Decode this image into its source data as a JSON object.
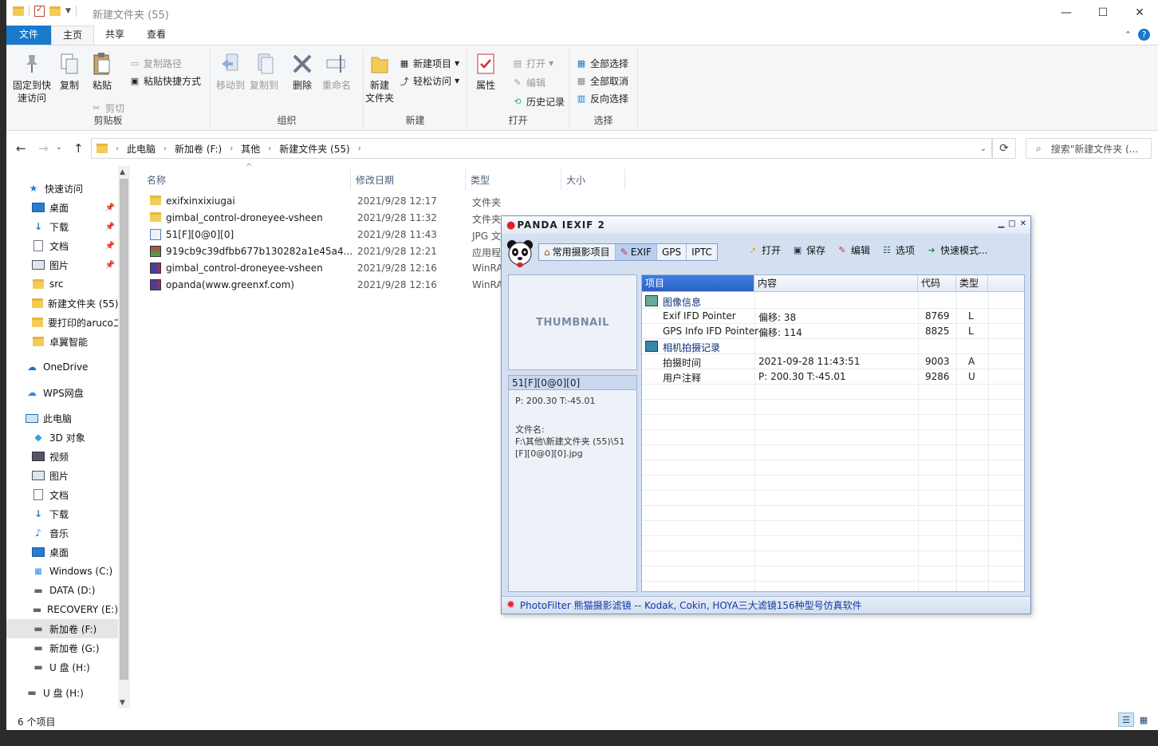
{
  "window": {
    "title": "新建文件夹 (55)"
  },
  "tabs": {
    "file": "文件",
    "home": "主页",
    "share": "共享",
    "view": "查看"
  },
  "ribbon": {
    "clipboard": {
      "label": "剪贴板",
      "pin": "固定到快速访问",
      "copy": "复制",
      "paste": "粘贴",
      "copy_path": "复制路径",
      "paste_shortcut": "粘贴快捷方式",
      "cut": "剪切"
    },
    "organize": {
      "label": "组织",
      "move_to": "移动到",
      "copy_to": "复制到",
      "delete": "删除",
      "rename": "重命名"
    },
    "new": {
      "label": "新建",
      "new_folder": "新建\n文件夹",
      "new_item": "新建项目",
      "easy_access": "轻松访问"
    },
    "open": {
      "label": "打开",
      "properties": "属性",
      "open": "打开",
      "edit": "编辑",
      "history": "历史记录"
    },
    "select": {
      "label": "选择",
      "select_all": "全部选择",
      "select_none": "全部取消",
      "invert": "反向选择"
    }
  },
  "address": {
    "crumbs": [
      "此电脑",
      "新加卷 (F:)",
      "其他",
      "新建文件夹 (55)"
    ],
    "search_placeholder": "搜索\"新建文件夹 (..."
  },
  "nav": {
    "quick_access": "快速访问",
    "items": [
      "桌面",
      "下载",
      "文档",
      "图片",
      "src",
      "新建文件夹 (55)",
      "要打印的aruco二",
      "卓翼智能"
    ],
    "onedrive": "OneDrive",
    "wps": "WPS网盘",
    "this_pc": "此电脑",
    "pc_items": [
      "3D 对象",
      "视频",
      "图片",
      "文档",
      "下载",
      "音乐",
      "桌面",
      "Windows (C:)",
      "DATA (D:)",
      "RECOVERY (E:)",
      "新加卷 (F:)",
      "新加卷 (G:)",
      "U 盘 (H:)"
    ],
    "usb": "U 盘 (H:)"
  },
  "columns": {
    "name": "名称",
    "date": "修改日期",
    "type": "类型",
    "size": "大小"
  },
  "files": [
    {
      "name": "exifxinxixiugai",
      "date": "2021/9/28 12:17",
      "type": "文件夹",
      "icon": "folder"
    },
    {
      "name": "gimbal_control-droneyee-vsheen",
      "date": "2021/9/28 11:32",
      "type": "文件夹",
      "icon": "folder"
    },
    {
      "name": "51[F][0@0][0]",
      "date": "2021/9/28 11:43",
      "type": "JPG 文",
      "icon": "jpg"
    },
    {
      "name": "919cb9c39dfbb677b130282a1e45a4...",
      "date": "2021/9/28 12:21",
      "type": "应用程",
      "icon": "exe"
    },
    {
      "name": "gimbal_control-droneyee-vsheen",
      "date": "2021/9/28 12:16",
      "type": "WinRA",
      "icon": "rar"
    },
    {
      "name": "opanda(www.greenxf.com)",
      "date": "2021/9/28 12:16",
      "type": "WinRA",
      "icon": "rar"
    }
  ],
  "status": {
    "count": "6 个项目"
  },
  "opanda": {
    "title": "PANDA IEXIF 2",
    "tabs": [
      "常用摄影项目",
      "EXIF",
      "GPS",
      "IPTC"
    ],
    "actions": [
      "打开",
      "保存",
      "编辑",
      "选项",
      "快速模式..."
    ],
    "thumbnail": "THUMBNAIL",
    "info_title": "51[F][0@0][0]",
    "info_lines": [
      "P: 200.30 T:-45.01",
      "",
      "文件名:",
      "F:\\其他\\新建文件夹 (55)\\51[F][0@0][0].jpg"
    ],
    "grid_headers": [
      "项目",
      "内容",
      "代码",
      "类型"
    ],
    "rows": [
      {
        "kind": "cat",
        "item": "图像信息"
      },
      {
        "kind": "row",
        "item": "Exif IFD Pointer",
        "content": "偏移: 38",
        "code": "8769",
        "type": "L"
      },
      {
        "kind": "row",
        "item": "GPS Info IFD Pointer",
        "content": "偏移: 114",
        "code": "8825",
        "type": "L"
      },
      {
        "kind": "cat",
        "item": "相机拍摄记录"
      },
      {
        "kind": "row",
        "item": "拍摄时间",
        "content": "2021-09-28 11:43:51",
        "code": "9003",
        "type": "A"
      },
      {
        "kind": "row",
        "item": "用户注释",
        "content": "P: 200.30 T:-45.01",
        "code": "9286",
        "type": "U"
      }
    ],
    "status_text": "PhotoFilter 熊猫摄影滤镜 -- Kodak, Cokin, HOYA三大滤镜156种型号仿真软件"
  }
}
